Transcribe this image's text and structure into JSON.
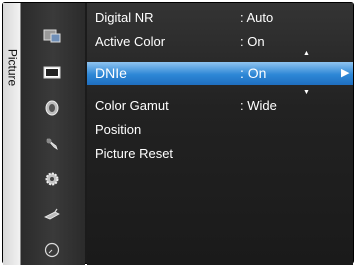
{
  "side_tab": {
    "label": "Picture"
  },
  "menu": {
    "items": [
      {
        "label": "Digital NR",
        "value": ": Auto"
      },
      {
        "label": "Active Color",
        "value": ": On"
      },
      {
        "label": "DNIe",
        "value": ": On",
        "selected": true
      },
      {
        "label": "Color Gamut",
        "value": ": Wide"
      },
      {
        "label": "Position",
        "value": ""
      },
      {
        "label": "Picture Reset",
        "value": ""
      }
    ]
  },
  "icons": [
    "input-icon",
    "picture-icon",
    "sound-icon",
    "channel-icon",
    "setup-icon",
    "plug-and-play-icon",
    "time-icon"
  ],
  "colors": {
    "selection_light": "#8fc4f0",
    "selection_dark": "#1f6fc0",
    "background": "#1b1b1b"
  }
}
